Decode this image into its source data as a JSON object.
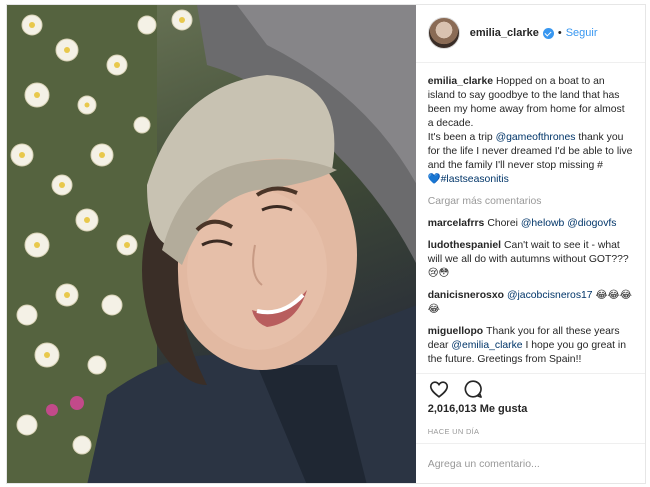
{
  "post": {
    "username": "emilia_clarke",
    "verified": true,
    "follow_label": "Seguir",
    "separator": "•",
    "caption": {
      "user": "emilia_clarke",
      "text_1": "Hopped on a boat to an island to say goodbye to the land that has been my home away from home for almost a decade.",
      "text_2": "It's been a trip ",
      "mention": "@gameofthrones",
      "text_3": " thank you for the life I never dreamed I'd be able to live and the family I'll never stop missing #",
      "hashtag": "💙#lastseasonitis"
    },
    "load_more_label": "Cargar más comentarios",
    "comments": [
      {
        "user": "marcelafrrs",
        "text_a": "Chorei ",
        "mention_a": "@helowb",
        "text_b": " ",
        "mention_b": "@diogovfs",
        "text_c": ""
      },
      {
        "user": "ludothespaniel",
        "text_a": "Can't wait to see it - what will we all do with autumns without GOT??? 😢😳",
        "mention_a": "",
        "text_b": "",
        "mention_b": "",
        "text_c": ""
      },
      {
        "user": "danicisnerosxo",
        "text_a": "",
        "mention_a": "@jacobcisneros17",
        "text_b": " 😂😂😂😂",
        "mention_b": "",
        "text_c": ""
      },
      {
        "user": "miguellopo",
        "text_a": "Thank you for all these years dear ",
        "mention_a": "@emilia_clarke",
        "text_b": " I hope you go great in the future. Greetings from Spain!!",
        "mention_b": "",
        "text_c": ""
      }
    ],
    "icons": {
      "like": "heart-icon",
      "comment": "comment-bubble-icon",
      "verified": "verified-badge-icon"
    },
    "likes_label": "2,016,013 Me gusta",
    "time_label": "HACE UN DÍA",
    "add_comment_placeholder": "Agrega un comentario...",
    "colors": {
      "link": "#003569",
      "follow": "#3897f0",
      "muted": "#999999",
      "text": "#262626"
    }
  }
}
